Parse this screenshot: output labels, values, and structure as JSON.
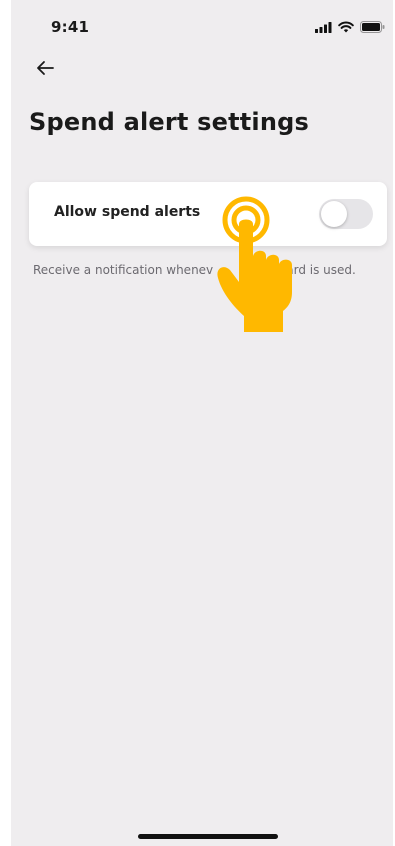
{
  "status_bar": {
    "time": "9:41",
    "icons": [
      "signal-icon",
      "wifi-icon",
      "battery-icon"
    ]
  },
  "header": {
    "back_icon": "back-arrow-icon",
    "title": "Spend alert settings"
  },
  "settings": {
    "allow_spend_alerts": {
      "label": "Allow spend alerts",
      "enabled": false
    },
    "helper_visible_text": [
      "Receive a notification whenev",
      "t card is used."
    ]
  },
  "overlay": {
    "icon": "tap-hand-icon",
    "color": "#ffb800"
  },
  "colors": {
    "background": "#efedef",
    "card": "#ffffff",
    "toggle_off": "#e6e5e8",
    "text": "#1a1a1a",
    "helper_text": "#6c6a70"
  }
}
